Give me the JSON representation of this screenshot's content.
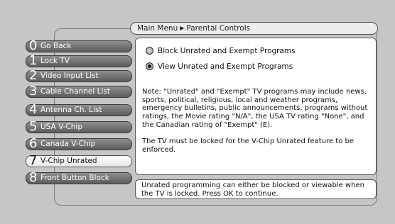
{
  "breadcrumb": {
    "root": "Main Menu",
    "current": "Parental Controls"
  },
  "menu": {
    "items": [
      {
        "num": "0",
        "label": "Go Back"
      },
      {
        "num": "1",
        "label": "Lock TV"
      },
      {
        "num": "2",
        "label": "Video Input List"
      },
      {
        "num": "3",
        "label": "Cable Channel List"
      },
      {
        "num": "4",
        "label": "Antenna Ch. List"
      },
      {
        "num": "5",
        "label": "USA V-Chip"
      },
      {
        "num": "6",
        "label": "Canada V-Chip"
      },
      {
        "num": "7",
        "label": "V-Chip Unrated"
      },
      {
        "num": "8",
        "label": "Front Button Block"
      }
    ],
    "selected_index": 7
  },
  "options": {
    "block_label": "Block Unrated and Exempt Programs",
    "view_label": "View Unrated and Exempt Programs",
    "selected": "view"
  },
  "note": {
    "paragraph1": "Note: \"Unrated\" and \"Exempt\" TV programs may include news, sports, political, religious, local and weather programs, emergency bulletins, public announcements, programs without ratings, the Movie rating \"N/A\", the USA TV rating \"None\", and the Canadian rating of \"Exempt\" (E).",
    "paragraph2": "The TV must be locked for the V-Chip Unrated feature to be enforced."
  },
  "help": {
    "text": "Unrated programming can either be blocked or viewable when the TV is locked. Press OK to continue."
  },
  "colors": {
    "background": "#c6c6c6",
    "button_dark": "#5c5c5c",
    "button_selected": "#ffffff"
  }
}
